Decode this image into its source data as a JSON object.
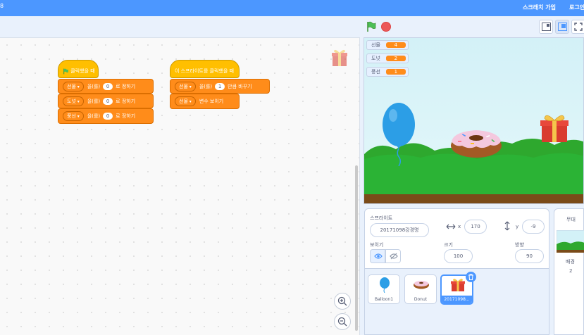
{
  "topbar": {
    "left_fragment": "8",
    "join": "스크래치 가입",
    "login": "로그인"
  },
  "blocks": {
    "hat1": {
      "label": "클릭했을 때"
    },
    "set1": {
      "var": "선물",
      "mid": "을(를)",
      "value": "0",
      "end": "로 정하기"
    },
    "set2": {
      "var": "도넛",
      "mid": "을(를)",
      "value": "0",
      "end": "로 정하기"
    },
    "set3": {
      "var": "풍선",
      "mid": "을(를)",
      "value": "0",
      "end": "로 정하기"
    },
    "hat2": {
      "label": "이 스프라이트를 클릭했을 때"
    },
    "change": {
      "var": "선물",
      "mid": "을(를)",
      "value": "1",
      "end": "만큼 바꾸기"
    },
    "show": {
      "var": "선물",
      "end": "변수 보이기"
    }
  },
  "monitors": [
    {
      "label": "선물",
      "value": "4"
    },
    {
      "label": "도넛",
      "value": "2"
    },
    {
      "label": "풍선",
      "value": "1"
    }
  ],
  "sprite_info": {
    "sprite_label": "스프라이트",
    "sprite_name": "20171098강경명",
    "x_label": "x",
    "x": "170",
    "y_label": "y",
    "y": "-9",
    "show_label": "보이기",
    "size_label": "크기",
    "size": "100",
    "direction_label": "방향",
    "direction": "90"
  },
  "sprites": [
    {
      "name": "Balloon1"
    },
    {
      "name": "Donut"
    },
    {
      "name": "201710​98..."
    }
  ],
  "stage_pane": {
    "title": "무대",
    "backdrop_label": "배경",
    "backdrop_count": "2"
  },
  "colors": {
    "accent": "#4c97ff",
    "events": "#ffbf00",
    "variables": "#ff8c1a"
  }
}
